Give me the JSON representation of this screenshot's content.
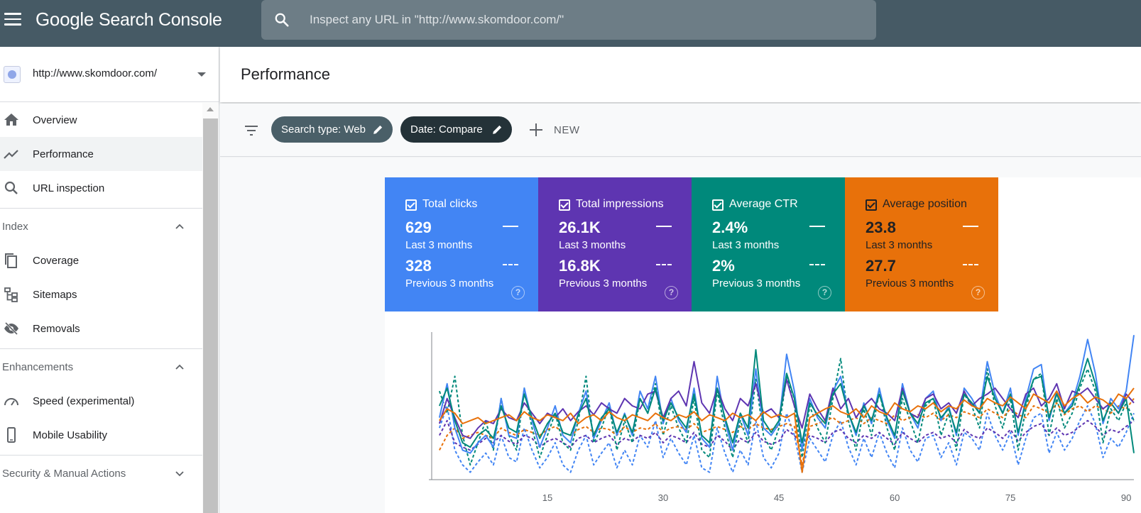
{
  "app": {
    "title_google": "Google",
    "title_product": "Search Console",
    "search_placeholder": "Inspect any URL in \"http://www.skomdoor.com/\""
  },
  "sidebar": {
    "property_url": "http://www.skomdoor.com/",
    "nav": [
      {
        "label": "Overview",
        "icon": "home-icon"
      },
      {
        "label": "Performance",
        "icon": "trending-up-icon",
        "active": true
      },
      {
        "label": "URL inspection",
        "icon": "search-icon"
      }
    ],
    "sections": [
      {
        "label": "Index",
        "expanded": true,
        "items": [
          {
            "label": "Coverage",
            "icon": "copy-icon"
          },
          {
            "label": "Sitemaps",
            "icon": "sitemap-icon"
          },
          {
            "label": "Removals",
            "icon": "eye-off-icon"
          }
        ]
      },
      {
        "label": "Enhancements",
        "expanded": true,
        "items": [
          {
            "label": "Speed (experimental)",
            "icon": "speedometer-icon"
          },
          {
            "label": "Mobile Usability",
            "icon": "phone-icon"
          }
        ]
      },
      {
        "label": "Security & Manual Actions",
        "expanded": false,
        "items": []
      }
    ]
  },
  "main": {
    "title": "Performance",
    "filters": {
      "search_type": "Search type: Web",
      "date": "Date: Compare",
      "new_label": "NEW"
    },
    "metrics": [
      {
        "name": "Total clicks",
        "value": "629",
        "period": "Last 3 months",
        "prev_value": "328",
        "prev_period": "Previous 3 months",
        "color": "#4285f4"
      },
      {
        "name": "Total impressions",
        "value": "26.1K",
        "period": "Last 3 months",
        "prev_value": "16.8K",
        "prev_period": "Previous 3 months",
        "color": "#5e35b1"
      },
      {
        "name": "Average CTR",
        "value": "2.4%",
        "period": "Last 3 months",
        "prev_value": "2%",
        "prev_period": "Previous 3 months",
        "color": "#00897b"
      },
      {
        "name": "Average position",
        "value": "23.8",
        "period": "Last 3 months",
        "prev_value": "27.7",
        "prev_period": "Previous 3 months",
        "color": "#e8710a"
      }
    ]
  },
  "chart_data": {
    "type": "line",
    "x_ticks": [
      15,
      30,
      45,
      60,
      75,
      90
    ],
    "xlim": [
      0,
      91
    ],
    "ylim": [
      0,
      1
    ],
    "grid": false,
    "legend": "none",
    "series": [
      {
        "metric": "Total clicks",
        "style": "solid",
        "color": "#4285f4",
        "values": [
          0.42,
          0.65,
          0.35,
          0.2,
          0.18,
          0.25,
          0.3,
          0.22,
          0.55,
          0.3,
          0.28,
          0.62,
          0.4,
          0.22,
          0.35,
          0.5,
          0.3,
          0.25,
          0.45,
          0.6,
          0.28,
          0.4,
          0.52,
          0.3,
          0.45,
          0.3,
          0.6,
          0.48,
          0.7,
          0.38,
          0.55,
          0.4,
          0.32,
          0.62,
          0.28,
          0.22,
          0.7,
          0.4,
          0.2,
          0.45,
          0.3,
          0.75,
          0.35,
          0.3,
          0.38,
          0.85,
          0.6,
          0.2,
          0.55,
          0.42,
          0.35,
          0.6,
          0.7,
          0.45,
          0.3,
          0.52,
          0.38,
          0.62,
          0.4,
          0.28,
          0.65,
          0.45,
          0.35,
          0.55,
          0.6,
          0.4,
          0.5,
          0.3,
          0.62,
          0.55,
          0.45,
          0.8,
          0.58,
          0.45,
          0.62,
          0.3,
          0.55,
          0.75,
          0.78,
          0.4,
          0.6,
          0.45,
          0.52,
          0.7,
          0.95,
          0.72,
          0.38,
          0.55,
          0.48,
          0.6,
          0.98
        ]
      },
      {
        "metric": "Total impressions",
        "style": "solid",
        "color": "#5e35b1",
        "values": [
          0.38,
          0.55,
          0.42,
          0.3,
          0.28,
          0.35,
          0.4,
          0.38,
          0.48,
          0.42,
          0.4,
          0.52,
          0.45,
          0.38,
          0.45,
          0.42,
          0.48,
          0.4,
          0.46,
          0.5,
          0.44,
          0.52,
          0.48,
          0.45,
          0.55,
          0.5,
          0.48,
          0.58,
          0.6,
          0.42,
          0.55,
          0.6,
          0.5,
          0.8,
          0.52,
          0.45,
          0.62,
          0.48,
          0.4,
          0.55,
          0.5,
          0.65,
          0.45,
          0.48,
          0.42,
          0.68,
          0.5,
          0.35,
          0.58,
          0.48,
          0.4,
          0.62,
          0.48,
          0.55,
          0.42,
          0.5,
          0.55,
          0.48,
          0.45,
          0.4,
          0.62,
          0.45,
          0.42,
          0.55,
          0.58,
          0.48,
          0.52,
          0.45,
          0.6,
          0.5,
          0.55,
          0.58,
          0.62,
          0.55,
          0.48,
          0.42,
          0.58,
          0.62,
          0.5,
          0.55,
          0.65,
          0.48,
          0.6,
          0.58,
          0.62,
          0.55,
          0.48,
          0.52,
          0.45,
          0.58,
          0.52
        ]
      },
      {
        "metric": "Average CTR",
        "style": "solid",
        "color": "#00897b",
        "values": [
          0.5,
          0.62,
          0.4,
          0.25,
          0.22,
          0.3,
          0.34,
          0.28,
          0.5,
          0.35,
          0.32,
          0.58,
          0.42,
          0.28,
          0.38,
          0.45,
          0.32,
          0.3,
          0.44,
          0.55,
          0.3,
          0.42,
          0.48,
          0.32,
          0.44,
          0.32,
          0.55,
          0.45,
          0.62,
          0.4,
          0.52,
          0.42,
          0.35,
          0.58,
          0.3,
          0.25,
          0.62,
          0.42,
          0.25,
          0.45,
          0.35,
          0.88,
          0.4,
          0.32,
          0.4,
          0.72,
          0.55,
          0.25,
          0.52,
          0.44,
          0.38,
          0.58,
          0.65,
          0.45,
          0.32,
          0.5,
          0.4,
          0.58,
          0.42,
          0.3,
          0.6,
          0.45,
          0.38,
          0.52,
          0.55,
          0.42,
          0.48,
          0.32,
          0.58,
          0.52,
          0.45,
          0.7,
          0.55,
          0.45,
          0.58,
          0.32,
          0.52,
          0.68,
          0.7,
          0.42,
          0.58,
          0.45,
          0.5,
          0.65,
          0.82,
          0.65,
          0.4,
          0.52,
          0.45,
          0.55,
          0.18
        ]
      },
      {
        "metric": "Average position",
        "style": "solid",
        "color": "#e8710a",
        "values": [
          0.4,
          0.48,
          0.45,
          0.38,
          0.4,
          0.42,
          0.38,
          0.4,
          0.42,
          0.44,
          0.4,
          0.46,
          0.42,
          0.4,
          0.44,
          0.42,
          0.4,
          0.45,
          0.38,
          0.42,
          0.44,
          0.4,
          0.46,
          0.42,
          0.4,
          0.44,
          0.42,
          0.4,
          0.45,
          0.42,
          0.4,
          0.44,
          0.42,
          0.46,
          0.4,
          0.44,
          0.42,
          0.4,
          0.45,
          0.42,
          0.44,
          0.4,
          0.46,
          0.42,
          0.44,
          0.42,
          0.45,
          0.05,
          0.42,
          0.45,
          0.48,
          0.5,
          0.46,
          0.44,
          0.48,
          0.42,
          0.5,
          0.46,
          0.44,
          0.52,
          0.48,
          0.46,
          0.5,
          0.48,
          0.52,
          0.46,
          0.5,
          0.48,
          0.54,
          0.5,
          0.48,
          0.55,
          0.52,
          0.5,
          0.56,
          0.52,
          0.48,
          0.58,
          0.55,
          0.52,
          0.6,
          0.5,
          0.55,
          0.58,
          0.52,
          0.56,
          0.54,
          0.5,
          0.58,
          0.55,
          0.62
        ]
      },
      {
        "metric": "Total clicks (previous)",
        "style": "dashed",
        "color": "#4285f4",
        "values": [
          0.35,
          0.5,
          0.2,
          0.1,
          0.05,
          0.12,
          0.18,
          0.1,
          0.3,
          0.15,
          0.12,
          0.35,
          0.2,
          0.08,
          0.15,
          0.25,
          0.1,
          0.05,
          0.2,
          0.3,
          0.1,
          0.18,
          0.25,
          0.08,
          0.2,
          0.1,
          0.3,
          0.22,
          0.4,
          0.15,
          0.28,
          0.18,
          0.1,
          0.3,
          0.08,
          0.05,
          0.35,
          0.18,
          0.05,
          0.2,
          0.1,
          0.4,
          0.15,
          0.08,
          0.18,
          0.45,
          0.3,
          0.05,
          0.28,
          0.2,
          0.12,
          0.3,
          0.4,
          0.22,
          0.1,
          0.28,
          0.15,
          0.32,
          0.18,
          0.08,
          0.35,
          0.2,
          0.12,
          0.28,
          0.3,
          0.15,
          0.25,
          0.1,
          0.32,
          0.28,
          0.2,
          0.45,
          0.3,
          0.2,
          0.32,
          0.1,
          0.28,
          0.42,
          0.45,
          0.18,
          0.32,
          0.2,
          0.28,
          0.4,
          0.5,
          0.38,
          0.15,
          0.28,
          0.22,
          0.32,
          0.45
        ]
      },
      {
        "metric": "Total impressions (previous)",
        "style": "dashed",
        "color": "#5e35b1",
        "values": [
          0.3,
          0.4,
          0.25,
          0.22,
          0.2,
          0.24,
          0.28,
          0.25,
          0.3,
          0.26,
          0.24,
          0.3,
          0.28,
          0.22,
          0.26,
          0.28,
          0.25,
          0.22,
          0.28,
          0.3,
          0.25,
          0.28,
          0.3,
          0.24,
          0.28,
          0.26,
          0.3,
          0.28,
          0.32,
          0.25,
          0.3,
          0.28,
          0.25,
          0.32,
          0.24,
          0.22,
          0.3,
          0.26,
          0.2,
          0.28,
          0.25,
          0.32,
          0.26,
          0.24,
          0.26,
          0.34,
          0.3,
          0.22,
          0.3,
          0.28,
          0.25,
          0.32,
          0.34,
          0.28,
          0.25,
          0.3,
          0.28,
          0.32,
          0.28,
          0.24,
          0.32,
          0.28,
          0.25,
          0.3,
          0.32,
          0.28,
          0.3,
          0.25,
          0.34,
          0.3,
          0.28,
          0.35,
          0.32,
          0.28,
          0.34,
          0.26,
          0.32,
          0.36,
          0.38,
          0.3,
          0.35,
          0.3,
          0.32,
          0.36,
          0.4,
          0.36,
          0.3,
          0.34,
          0.32,
          0.36,
          0.4
        ]
      },
      {
        "metric": "Average CTR (previous)",
        "style": "dashed",
        "color": "#00897b",
        "values": [
          0.6,
          0.45,
          0.7,
          0.3,
          0.1,
          0.25,
          0.4,
          0.2,
          0.55,
          0.3,
          0.2,
          0.62,
          0.35,
          0.15,
          0.3,
          0.45,
          0.25,
          0.2,
          0.4,
          0.7,
          0.25,
          0.35,
          0.5,
          0.2,
          0.4,
          0.25,
          0.55,
          0.45,
          0.65,
          0.3,
          0.5,
          0.35,
          0.25,
          0.55,
          0.2,
          0.15,
          0.6,
          0.35,
          0.15,
          0.4,
          0.25,
          0.68,
          0.3,
          0.2,
          0.35,
          0.7,
          0.5,
          0.15,
          0.5,
          0.35,
          0.25,
          0.55,
          0.82,
          0.4,
          0.2,
          0.48,
          0.3,
          0.6,
          0.35,
          0.2,
          0.55,
          0.4,
          0.25,
          0.5,
          0.55,
          0.3,
          0.45,
          0.2,
          0.58,
          0.5,
          0.35,
          0.75,
          0.5,
          0.35,
          0.55,
          0.2,
          0.48,
          0.68,
          0.72,
          0.3,
          0.55,
          0.35,
          0.45,
          0.62,
          0.75,
          0.6,
          0.25,
          0.48,
          0.4,
          0.52,
          0.4
        ]
      },
      {
        "metric": "Average position (previous)",
        "style": "dashed",
        "color": "#e8710a",
        "values": [
          0.2,
          0.3,
          0.35,
          0.28,
          0.3,
          0.32,
          0.3,
          0.28,
          0.35,
          0.32,
          0.3,
          0.34,
          0.32,
          0.3,
          0.34,
          0.36,
          0.32,
          0.3,
          0.34,
          0.36,
          0.32,
          0.35,
          0.34,
          0.3,
          0.36,
          0.32,
          0.35,
          0.34,
          0.38,
          0.32,
          0.35,
          0.36,
          0.34,
          0.38,
          0.32,
          0.34,
          0.36,
          0.34,
          0.32,
          0.36,
          0.34,
          0.38,
          0.35,
          0.34,
          0.36,
          0.38,
          0.36,
          0.1,
          0.36,
          0.38,
          0.4,
          0.42,
          0.38,
          0.4,
          0.42,
          0.38,
          0.42,
          0.4,
          0.38,
          0.44,
          0.4,
          0.42,
          0.44,
          0.42,
          0.45,
          0.4,
          0.44,
          0.42,
          0.46,
          0.44,
          0.42,
          0.48,
          0.45,
          0.42,
          0.48,
          0.44,
          0.42,
          0.5,
          0.48,
          0.45,
          0.52,
          0.44,
          0.48,
          0.5,
          0.46,
          0.5,
          0.48,
          0.45,
          0.5,
          0.48,
          0.55
        ]
      }
    ]
  }
}
